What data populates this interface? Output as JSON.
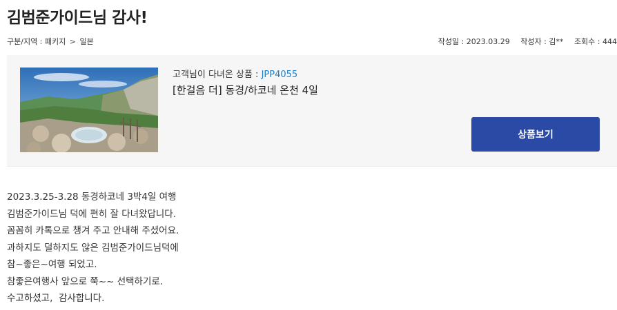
{
  "post": {
    "title": "김범준가이드님 감사!",
    "breadcrumb": {
      "category": "구분/지역 : 패키지",
      "separator": ">",
      "region": "일본"
    },
    "date_label": "작성일 : 2023.03.29",
    "author_label": "작성자 : 김**",
    "views_label": "조회수 : 444"
  },
  "product": {
    "code_prefix": "고객님이 다녀온 상품 : ",
    "code": "JPP4055",
    "name": "[한걸음 더] 동경/하코네 온천 4일",
    "button_label": "상품보기"
  },
  "body": {
    "lines": [
      "2023.3.25-3.28 동경하코네 3박4일 여행",
      "김범준가이드님 덕에 편히 잘 다녀왔답니다.",
      "꼼꼼히 카톡으로 챙겨 주고 안내해 주셨어요.",
      "과하지도 덜하지도 않은 김범준가이드님덕에",
      "참~좋은~여행 되었고.",
      "참좋은여행사 앞으로 쭉~~ 선택하기로.",
      "수고하셨고,  감사합니다."
    ]
  },
  "colors": {
    "button_bg": "#2a4aa6",
    "code_link": "#1f7fc4",
    "box_bg": "#f6f6f6"
  }
}
